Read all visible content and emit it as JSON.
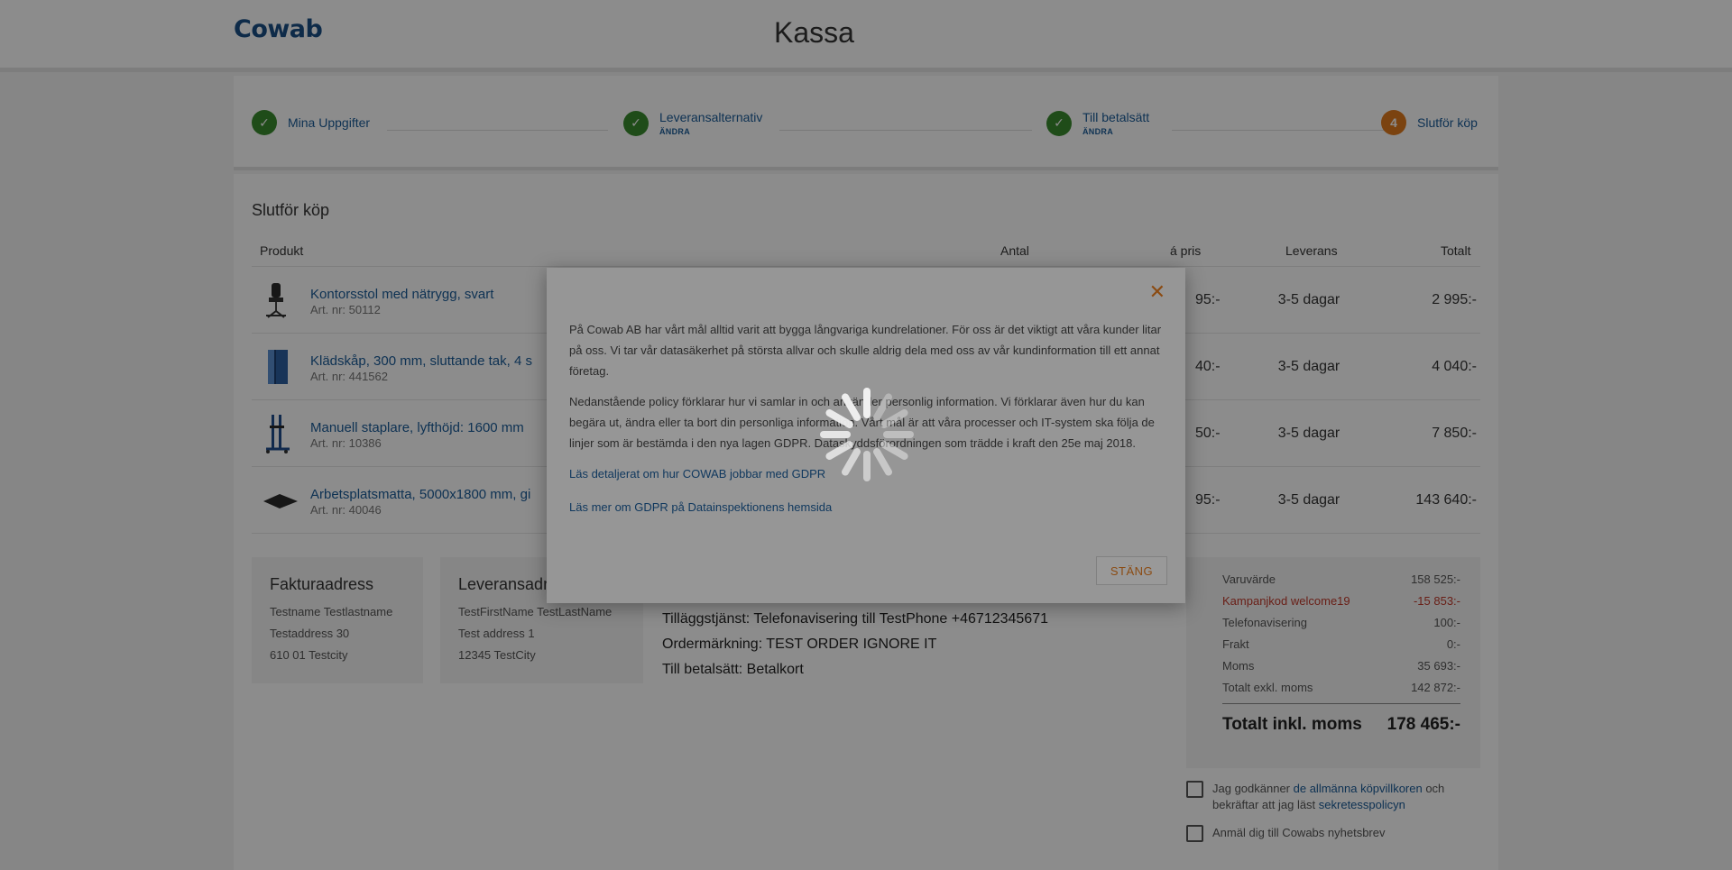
{
  "header": {
    "logo": "Cowab",
    "title": "Kassa"
  },
  "steps": [
    {
      "label": "Mina Uppgifter",
      "sub": "",
      "state": "done",
      "icon": "check-icon"
    },
    {
      "label": "Leveransalternativ",
      "sub": "ÄNDRA",
      "state": "done",
      "icon": "check-icon"
    },
    {
      "label": "Till betalsätt",
      "sub": "ÄNDRA",
      "state": "done",
      "icon": "check-icon"
    },
    {
      "label": "Slutför köp",
      "sub": "",
      "state": "current",
      "number": "4"
    }
  ],
  "order": {
    "title": "Slutför köp",
    "columns": {
      "product": "Produkt",
      "qty": "Antal",
      "unit_price": "á pris",
      "delivery": "Leverans",
      "total": "Totalt"
    },
    "rows": [
      {
        "name": "Kontorsstol med nätrygg, svart",
        "art": "Art. nr: 50112",
        "price": "95:-",
        "delivery": "3-5 dagar",
        "total": "2 995:-"
      },
      {
        "name": "Klädskåp, 300 mm, sluttande tak, 4 s",
        "art": "Art. nr: 441562",
        "price": "40:-",
        "delivery": "3-5 dagar",
        "total": "4 040:-"
      },
      {
        "name": "Manuell staplare, lyfthöjd: 1600 mm",
        "art": "Art. nr: 10386",
        "price": "50:-",
        "delivery": "3-5 dagar",
        "total": "7 850:-"
      },
      {
        "name": "Arbetsplatsmatta, 5000x1800 mm, gi",
        "art": "Art. nr: 40046",
        "price": "95:-",
        "delivery": "3-5 dagar",
        "total": "143 640:-"
      }
    ]
  },
  "billing": {
    "title": "Fakturaadress",
    "line1": "Testname Testlastname",
    "line2": "Testaddress 30",
    "line3": "610 01 Testcity"
  },
  "shipping": {
    "title": "Leveransadr",
    "line1": "TestFirstName TestLastName",
    "line2": "Test address 1",
    "line3": "12345 TestCity"
  },
  "info": {
    "service": "Tilläggstjänst: Telefonavisering till TestPhone +46712345671",
    "marking": "Ordermärkning: TEST ORDER IGNORE IT",
    "payment": "Till betalsätt: Betalkort"
  },
  "summary": {
    "rows": [
      {
        "label": "Varuvärde",
        "value": "158 525:-"
      },
      {
        "label": "Kampanjkod welcome19",
        "value": "-15 853:-"
      },
      {
        "label": "Telefonavisering",
        "value": "100:-"
      },
      {
        "label": "Frakt",
        "value": "0:-"
      },
      {
        "label": "Moms",
        "value": "35 693:-"
      },
      {
        "label": "Totalt exkl. moms",
        "value": "142 872:-"
      }
    ],
    "total_label": "Totalt inkl. moms",
    "total_value": "178 465:-",
    "campaign_color": "#c0392b"
  },
  "terms": {
    "pre": "Jag godkänner ",
    "link1": "de allmänna köpvillkoren",
    "mid": " och bekräftar att jag läst ",
    "link2": "sekretesspolicyn"
  },
  "newsletter": "Anmäl dig till Cowabs nyhetsbrev",
  "modal": {
    "close_icon": "close-icon",
    "p1": "På Cowab AB har vårt mål alltid varit att bygga långvariga kundrelationer. För oss är det viktigt att våra kunder litar på oss. Vi tar vår datasäkerhet på största allvar och skulle aldrig dela med oss av vår kundinformation till ett annat företag.",
    "p2": "Nedanstående policy förklarar hur vi samlar in och använder personlig information. Vi förklarar även hur du kan begära ut, ändra eller ta bort din personliga information. Vårt mål är att våra processer och IT-system ska följa de linjer som är bestämda i den nya lagen GDPR. Dataskyddsförordningen som trädde i kraft den 25e maj 2018.",
    "link1": "Läs detaljerat om hur COWAB jobbar med GDPR",
    "link2": "Läs mer om GDPR på Datainspektionens hemsida",
    "close_button": "STÄNG"
  },
  "colors": {
    "brand": "#1a4f86",
    "accent": "#e07a1e",
    "done": "#3a8a2e",
    "link": "#1a5b98"
  }
}
